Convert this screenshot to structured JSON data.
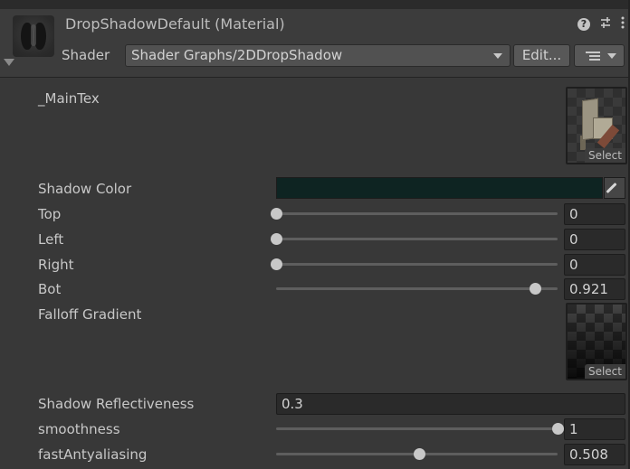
{
  "header": {
    "title": "DropShadowDefault (Material)",
    "shader_label": "Shader",
    "shader_value": "Shader Graphs/2DDropShadow",
    "edit_label": "Edit...",
    "icons": [
      "help-icon",
      "preset-sliders-icon",
      "kebab-menu-icon"
    ]
  },
  "properties": {
    "main_tex": {
      "label": "_MainTex",
      "select": "Select"
    },
    "shadow_color": {
      "label": "Shadow Color",
      "color": "#0e2422"
    },
    "top": {
      "label": "Top",
      "value": "0",
      "fraction": 0
    },
    "left": {
      "label": "Left",
      "value": "0",
      "fraction": 0
    },
    "right": {
      "label": "Right",
      "value": "0",
      "fraction": 0
    },
    "bot": {
      "label": "Bot",
      "value": "0.921",
      "fraction": 0.921
    },
    "falloff": {
      "label": "Falloff Gradient",
      "select": "Select"
    },
    "reflectiveness": {
      "label": "Shadow Reflectiveness",
      "value": "0.3"
    },
    "smoothness": {
      "label": "smoothness",
      "value": "1",
      "fraction": 1
    },
    "fast_aa": {
      "label": "fastAntyaliasing",
      "value": "0.508",
      "fraction": 0.508
    }
  }
}
